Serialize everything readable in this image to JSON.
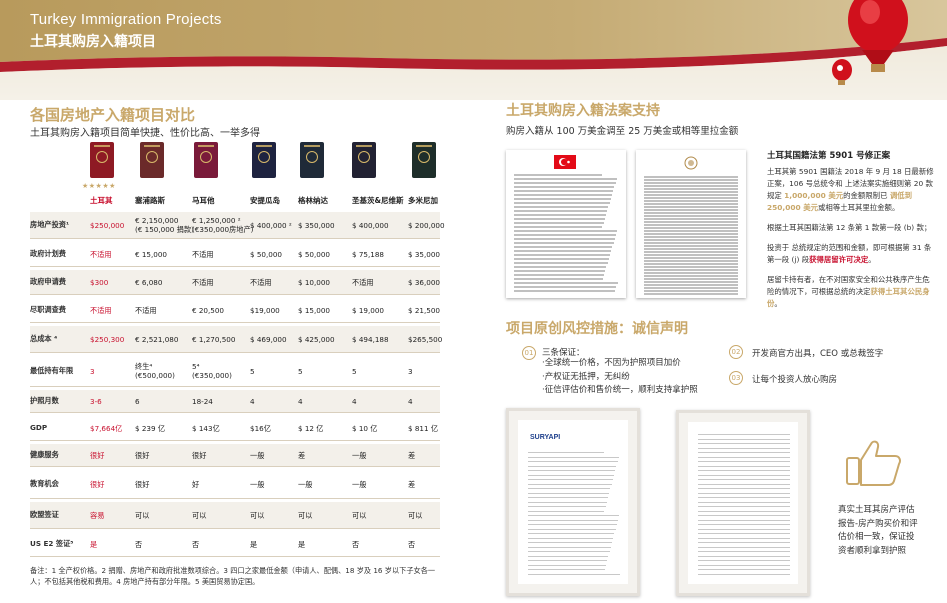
{
  "header": {
    "title": "Turkey Immigration Projects",
    "subtitle": "土耳其购房入籍项目"
  },
  "left": {
    "title": "各国房地产入籍项目对比",
    "subtitle": "土耳其购房入籍项目简单快捷、性价比高、一举多得",
    "stars": "★★★★★",
    "passport_colors": [
      "#8e1a24",
      "#6b2a2a",
      "#7a1a3a",
      "#1e2340",
      "#1f2a38",
      "#222233",
      "#1e2e2a"
    ],
    "columns": [
      "土耳其",
      "塞浦路斯",
      "马耳他",
      "安提瓜岛",
      "格林纳达",
      "圣基茨&尼维斯",
      "多米尼加"
    ],
    "rows": [
      {
        "label": "房地产投资¹",
        "cells": [
          "$250,000",
          "€ 2,150,000\n(€ 150,000 捐款)",
          "€ 1,250,000 ²\n(€350,000房地产)",
          "$ 400,000 ²",
          "$ 350,000",
          "$ 400,000",
          "$ 200,000"
        ]
      },
      {
        "label": "政府计划费",
        "cells": [
          "不适用",
          "€ 15,000",
          "不适用",
          "$ 50,000",
          "$ 50,000",
          "$ 75,188",
          "$ 35,000"
        ]
      },
      {
        "label": "政府申请费",
        "cells": [
          "$300",
          "€ 6,080",
          "不适用",
          "不适用",
          "$ 10,000",
          "不适用",
          "$ 36,000"
        ]
      },
      {
        "label": "尽职调查费",
        "cells": [
          "不适用",
          "不适用",
          "€ 20,500",
          "$19,000",
          "$ 15,000",
          "$ 19,000",
          "$ 21,500"
        ]
      },
      {
        "label": "总成本 ⁴",
        "cells": [
          "$250,300",
          "€ 2,521,080",
          "€ 1,270,500",
          "$ 469,000",
          "$ 425,000",
          "$ 494,188",
          "$265,500"
        ]
      },
      {
        "label": "最低持有年限",
        "cells": [
          "3",
          "终生⁴\n(€500,000)",
          "5⁴\n(€350,000)",
          "5",
          "5",
          "5",
          "3"
        ]
      },
      {
        "label": "护照月数",
        "cells": [
          "3-6",
          "6",
          "18-24",
          "4",
          "4",
          "4",
          "4"
        ]
      },
      {
        "label": "GDP",
        "cells": [
          "$7,664亿",
          "$ 239 亿",
          "$ 143亿",
          "$16亿",
          "$ 12 亿",
          "$ 10 亿",
          "$ 811 亿"
        ]
      },
      {
        "label": "健康服务",
        "cells": [
          "很好",
          "很好",
          "很好",
          "一般",
          "差",
          "一般",
          "差"
        ]
      },
      {
        "label": "教育机会",
        "cells": [
          "很好",
          "很好",
          "好",
          "一般",
          "一般",
          "一般",
          "差"
        ]
      },
      {
        "label": "欧盟签证",
        "cells": [
          "容易",
          "可以",
          "可以",
          "可以",
          "可以",
          "可以",
          "可以"
        ]
      },
      {
        "label": "US E2 签证⁵",
        "cells": [
          "是",
          "否",
          "否",
          "是",
          "是",
          "否",
          "否"
        ]
      }
    ],
    "note": "备注：1 全产权价格。2 捐赠、房地产和政府批准数项综合。3 四口之家最低金额（申请人、配偶、18 岁及 16 岁以下子女各一人；不包括其他税和费用。4 房地产持有部分年限。5 美国贸易协定国。"
  },
  "right": {
    "title": "土耳其购房入籍法案支持",
    "subtitle": "购房入籍从 100 万美金调至 25 万美金或相等里拉金额",
    "law_title": "土耳其国籍法第 5901 号修正案",
    "law_p1_a": "土耳其第 5901 国籍法 2018 年 9 月 18 日最新修正案，106 号总统令和 上述法案实施细则第 20 款规定 ",
    "law_p1_b": "1,000,000 美元",
    "law_p1_c": "的金额限制已 ",
    "law_p1_d": "调低到 250,000 美元",
    "law_p1_e": "或相等土耳其里拉金额。",
    "law_p2": "根据土耳其国籍法第 12 条第 1 款第一段 (b) 款；",
    "law_p3_a": "投资于 总统规定的范围和金额，即可根据第 31 条第一段 (j) 段",
    "law_p3_b": "获得居留许可决定",
    "law_p3_c": "。",
    "law_p4_a": "居留卡持有者，在不对国家安全和公共秩序产生危险的情况下，可根据总统的决定",
    "law_p4_b": "获得土耳其公民身份",
    "law_p4_c": "。",
    "risk_title": "项目原创风控措施：诚信声明",
    "risk_nums": [
      "01",
      "02",
      "03"
    ],
    "risk1_head": "三条保证：",
    "risk1_items": [
      "·全球统一价格，不因为护照项目加价",
      "·产权证无抵押，无纠纷",
      "·征信评估价和售价统一，顺利支持拿护照"
    ],
    "risk2": "开发商官方出具，CEO 或总裁签字",
    "risk3": "让每个投资人放心购房",
    "cert_logo": "SURYAPI",
    "bottom_note": "真实土耳其房产评估报告-房产购买价和评估价相一致，保证投资者顺利拿到护照"
  },
  "colors": {
    "gold": "#c9a86a",
    "red": "#c8102e",
    "header_bg": "#b99a5e"
  }
}
